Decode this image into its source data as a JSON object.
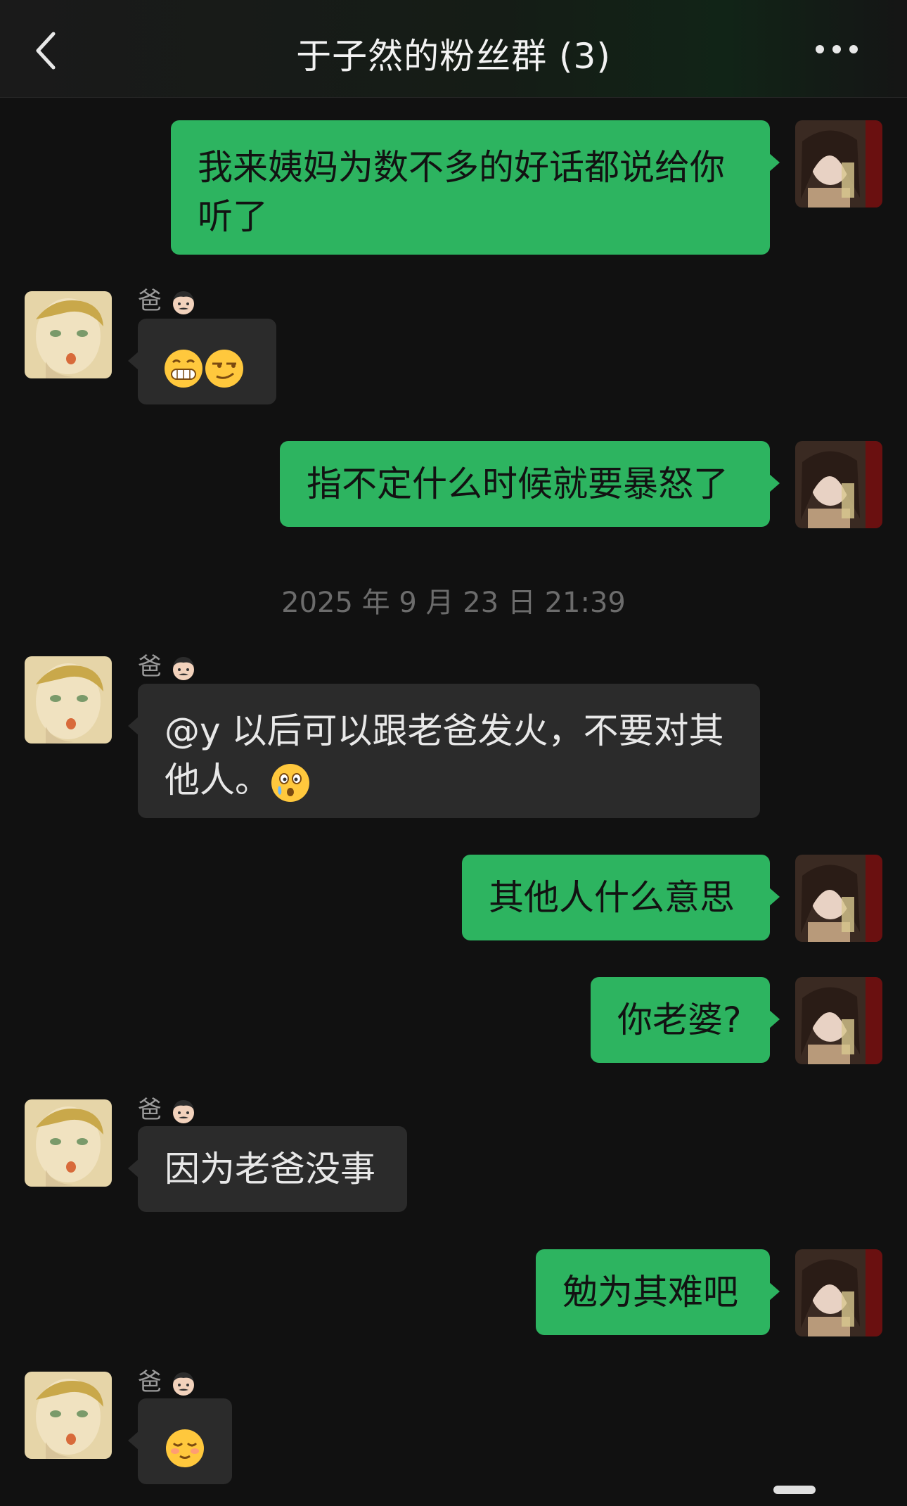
{
  "header": {
    "title": "于子然的粉丝群 (3)",
    "back_icon": "chevron-left-icon",
    "more_icon": "more-dots-icon"
  },
  "messages": [
    {
      "side": "me",
      "text": "我来姨妈为数不多的好话都说给你听了"
    },
    {
      "side": "them",
      "sender": "爸",
      "content": "emoji: grin, smirk"
    },
    {
      "side": "me",
      "text": "指不定什么时候就要暴怒了"
    },
    {
      "side": "them",
      "sender": "爸",
      "text": "@y 以后可以跟老爸发火，不要对其他人。"
    },
    {
      "side": "me",
      "text": "其他人什么意思"
    },
    {
      "side": "me",
      "text": "你老婆?"
    },
    {
      "side": "them",
      "sender": "爸",
      "text": "因为老爸没事"
    },
    {
      "side": "me",
      "text": "勉为其难吧"
    },
    {
      "side": "them",
      "sender": "爸",
      "content": "emoji: blush"
    }
  ],
  "timestamp": "2025 年 9 月 23 日 21:39",
  "colors": {
    "background": "#111111",
    "my_bubble": "#2db460",
    "their_bubble": "#2b2b2b"
  }
}
